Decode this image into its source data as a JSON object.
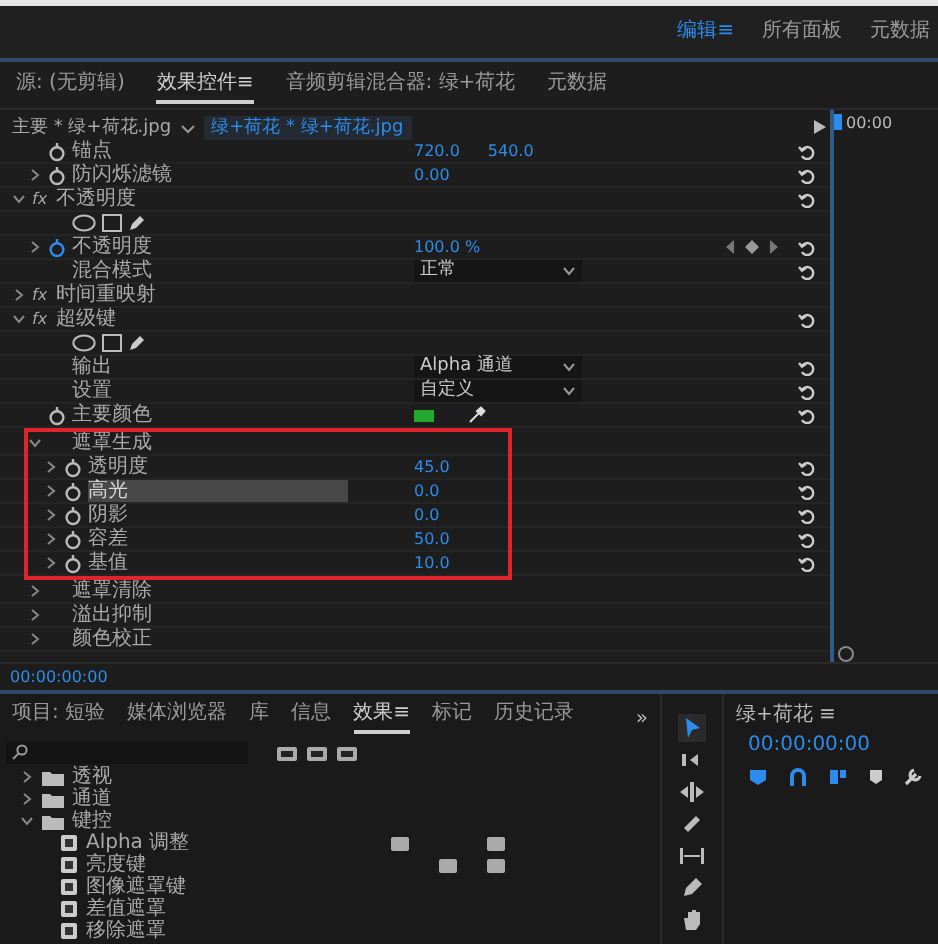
{
  "workspaces": [
    {
      "label": "编辑",
      "selected": true,
      "menu": "≡"
    },
    {
      "label": "所有面板",
      "selected": false
    },
    {
      "label": "元数据",
      "selected": false
    }
  ],
  "top_panel": {
    "tabs": [
      {
        "label": "源: (无剪辑)",
        "selected": false
      },
      {
        "label": "效果控件",
        "selected": true,
        "menu": "≡"
      },
      {
        "label": "音频剪辑混合器: 绿+荷花",
        "selected": false
      },
      {
        "label": "元数据",
        "selected": false
      }
    ],
    "clip_master": "主要 * 绿+荷花.jpg",
    "clip_selected": "绿+荷花 * 绿+荷花.jpg",
    "timeline_time": "00:00",
    "rows": [
      {
        "kind": "param",
        "label": "锚点",
        "keyframed": false,
        "values": [
          "720.0",
          "540.0"
        ]
      },
      {
        "kind": "param",
        "label": "防闪烁滤镜",
        "expandable": true,
        "keyframed": false,
        "values": [
          "0.00"
        ]
      },
      {
        "kind": "effect",
        "badge": "fx",
        "label": "不透明度",
        "expanded": true,
        "children": [
          {
            "kind": "masks"
          },
          {
            "kind": "param",
            "label": "不透明度",
            "expandable": true,
            "keyframed": true,
            "values": [
              "100.0 %"
            ],
            "keyframe_nav": true
          },
          {
            "kind": "dropdown",
            "label": "混合模式",
            "value": "正常"
          }
        ]
      },
      {
        "kind": "effect",
        "badge": "fx",
        "label": "时间重映射",
        "expanded": false
      },
      {
        "kind": "effect",
        "badge": "fx",
        "label": "超级键",
        "expanded": true,
        "children": [
          {
            "kind": "masks"
          },
          {
            "kind": "dropdown",
            "label": "输出",
            "value": "Alpha 通道"
          },
          {
            "kind": "dropdown",
            "label": "设置",
            "value": "自定义"
          },
          {
            "kind": "color",
            "label": "主要颜色",
            "color": "#22a82c"
          },
          {
            "kind": "group",
            "label": "遮罩生成",
            "expanded": true,
            "highlighted": true,
            "children": [
              {
                "kind": "param",
                "label": "透明度",
                "expandable": true,
                "keyframed": false,
                "selected": false,
                "values": [
                  "45.0"
                ]
              },
              {
                "kind": "param",
                "label": "高光",
                "expandable": true,
                "keyframed": false,
                "selected": true,
                "values": [
                  "0.0"
                ]
              },
              {
                "kind": "param",
                "label": "阴影",
                "expandable": true,
                "keyframed": false,
                "selected": false,
                "values": [
                  "0.0"
                ]
              },
              {
                "kind": "param",
                "label": "容差",
                "expandable": true,
                "keyframed": false,
                "selected": false,
                "values": [
                  "50.0"
                ]
              },
              {
                "kind": "param",
                "label": "基值",
                "expandable": true,
                "keyframed": false,
                "selected": false,
                "values": [
                  "10.0"
                ]
              }
            ]
          },
          {
            "kind": "group",
            "label": "遮罩清除",
            "expanded": false,
            "highlighted": false
          },
          {
            "kind": "group",
            "label": "溢出抑制",
            "expanded": false,
            "highlighted": false
          },
          {
            "kind": "group",
            "label": "颜色校正",
            "expanded": false,
            "highlighted": false
          }
        ]
      }
    ],
    "timecode": "00:00:00:00"
  },
  "bottom_panel": {
    "tabs": [
      {
        "label": "项目: 短验",
        "selected": false
      },
      {
        "label": "媒体浏览器",
        "selected": false
      },
      {
        "label": "库",
        "selected": false
      },
      {
        "label": "信息",
        "selected": false
      },
      {
        "label": "效果",
        "selected": true,
        "menu": "≡"
      },
      {
        "label": "标记",
        "selected": false
      },
      {
        "label": "历史记录",
        "selected": false
      }
    ],
    "overflow": "»",
    "tree": [
      {
        "label": "透视",
        "expanded": false
      },
      {
        "label": "通道",
        "expanded": false
      },
      {
        "label": "键控",
        "expanded": true,
        "children": [
          {
            "label": "Alpha 调整",
            "accelerated": true,
            "yuv": true
          },
          {
            "label": "亮度键",
            "bit32": true,
            "yuv": true
          },
          {
            "label": "图像遮罩键"
          },
          {
            "label": "差值遮罩"
          },
          {
            "label": "移除遮罩"
          }
        ]
      }
    ]
  },
  "tools": [
    {
      "kind": "selection",
      "selected": true
    },
    {
      "kind": "track-select",
      "selected": false
    },
    {
      "kind": "ripple",
      "selected": false
    },
    {
      "kind": "razor",
      "selected": false
    },
    {
      "kind": "slip",
      "selected": false
    },
    {
      "kind": "pen",
      "selected": false
    },
    {
      "kind": "hand",
      "selected": false
    }
  ],
  "program_monitor": {
    "title": "绿+荷花",
    "menu": "≡",
    "timecode": "00:00:00:00"
  }
}
